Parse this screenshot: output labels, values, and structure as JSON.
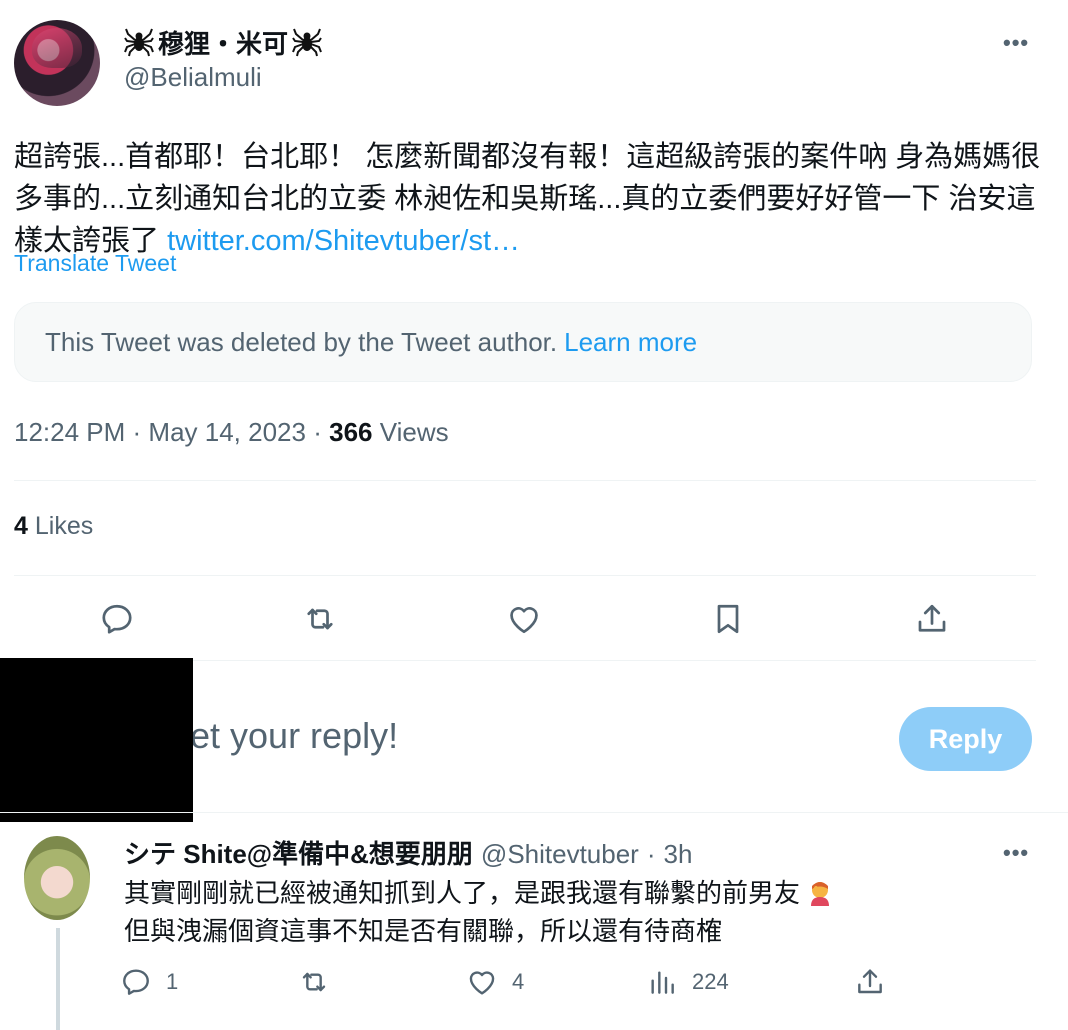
{
  "tweet": {
    "author_name": "穆狸・米可",
    "author_handle": "@Belialmuli",
    "text_before_link": "超誇張...首都耶！台北耶！ 怎麼新聞都沒有報！這超級誇張的案件吶 身為媽媽很多事的...立刻通知台北的立委 林昶佐和吳斯瑤...真的立委們要好好管一下 治安這樣太誇張了 ",
    "link_text": "twitter.com/Shitevtuber/st…",
    "translate_label": "Translate Tweet",
    "deleted_notice": "This Tweet was deleted by the Tweet author.",
    "learn_more": "Learn more",
    "time": "12:24 PM",
    "date": "May 14, 2023",
    "views_count": "366",
    "views_label": "Views",
    "likes_count": "4",
    "likes_label": "Likes"
  },
  "reply_box": {
    "placeholder_visible": "et your reply!",
    "button_label": "Reply"
  },
  "reply_tweet": {
    "author_name": "シテ Shite@準備中&想要朋朋",
    "author_handle": "@Shitevtuber",
    "age": "3h",
    "line1": "其實剛剛就已經被通知抓到人了，是跟我還有聯繫的前男友",
    "line2": "但與洩漏個資這事不知是否有關聯，所以還有待商榷",
    "reply_count": "1",
    "retweet_count": "",
    "like_count": "4",
    "view_count": "224"
  },
  "icons": {
    "spider": "spider-icon",
    "more": "more-icon",
    "reply": "reply-icon",
    "retweet": "retweet-icon",
    "like": "heart-icon",
    "bookmark": "bookmark-icon",
    "share": "share-icon",
    "views": "views-icon"
  },
  "colors": {
    "accent": "#1d9bf0",
    "reply_button": "#8ecdf8",
    "muted": "#536471"
  }
}
